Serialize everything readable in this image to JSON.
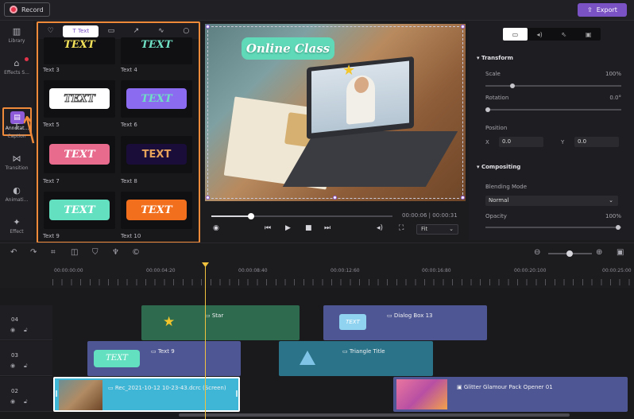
{
  "topbar": {
    "record_label": "Record",
    "export_label": "Export"
  },
  "sidebar": {
    "items": [
      {
        "label": "Library",
        "icon": "library-icon"
      },
      {
        "label": "Effects S...",
        "icon": "effects-store-icon"
      },
      {
        "label": "Annotat...",
        "icon": "annotation-icon"
      },
      {
        "label": "Caption",
        "icon": "caption-icon"
      },
      {
        "label": "Transition",
        "icon": "transition-icon"
      },
      {
        "label": "Animati...",
        "icon": "animation-icon"
      },
      {
        "label": "Effect",
        "icon": "effect-icon"
      }
    ]
  },
  "annotation_panel": {
    "tabs": [
      {
        "icon": "heart-icon"
      },
      {
        "label": "Text",
        "icon": "text-icon",
        "active": true
      },
      {
        "icon": "speech-bubble-icon"
      },
      {
        "icon": "arrow-icon"
      },
      {
        "icon": "wave-icon"
      },
      {
        "icon": "circle-icon"
      }
    ],
    "tiles": [
      {
        "label": "Text 3",
        "chip_text": "TEXT"
      },
      {
        "label": "Text 4",
        "chip_text": "TEXT"
      },
      {
        "label": "Text 5",
        "chip_text": "TEXT"
      },
      {
        "label": "Text 6",
        "chip_text": "TEXT"
      },
      {
        "label": "Text 7",
        "chip_text": "TEXT"
      },
      {
        "label": "Text 8",
        "chip_text": "TEXT"
      },
      {
        "label": "Text 9",
        "chip_text": "TEXT"
      },
      {
        "label": "Text 10",
        "chip_text": "TEXT"
      }
    ]
  },
  "preview": {
    "title_text": "Online Class"
  },
  "transport": {
    "timecode": "00:00:06 | 00:00:31",
    "fit_label": "Fit",
    "progress": 0.22
  },
  "properties": {
    "tabs": [
      "video-icon",
      "audio-icon",
      "cursor-icon",
      "caption-icon"
    ],
    "transform": {
      "heading": "Transform",
      "scale_label": "Scale",
      "scale_value": "100%",
      "rotation_label": "Rotation",
      "rotation_value": "0.0°",
      "position_label": "Position",
      "x_label": "X",
      "x_value": "0.0",
      "y_label": "Y",
      "y_value": "0.0"
    },
    "compositing": {
      "heading": "Compositing",
      "blend_label": "Blending Mode",
      "blend_value": "Normal",
      "opacity_label": "Opacity",
      "opacity_value": "100%"
    }
  },
  "timeline": {
    "ruler_labels": [
      "00:00:00:00",
      "00:00:04:20",
      "00:00:08:40",
      "00:00:12:60",
      "00:00:16:80",
      "00:00:20:100",
      "00:00:25:00"
    ],
    "tracks": [
      {
        "number": "04",
        "clips": [
          {
            "label": "Star"
          },
          {
            "label": "Dialog Box 13"
          }
        ]
      },
      {
        "number": "03",
        "clips": [
          {
            "label": "Text 9"
          },
          {
            "label": "Triangle Title"
          }
        ]
      },
      {
        "number": "02",
        "clips": [
          {
            "label": "Rec_2021-10-12 10-23-43.dcrc (Screen)"
          },
          {
            "label": "Glitter Glamour Pack Opener 01"
          }
        ]
      }
    ]
  },
  "colors": {
    "accent": "#7a52c4",
    "highlight": "#ef8a3a",
    "playhead": "#f0c23d"
  }
}
